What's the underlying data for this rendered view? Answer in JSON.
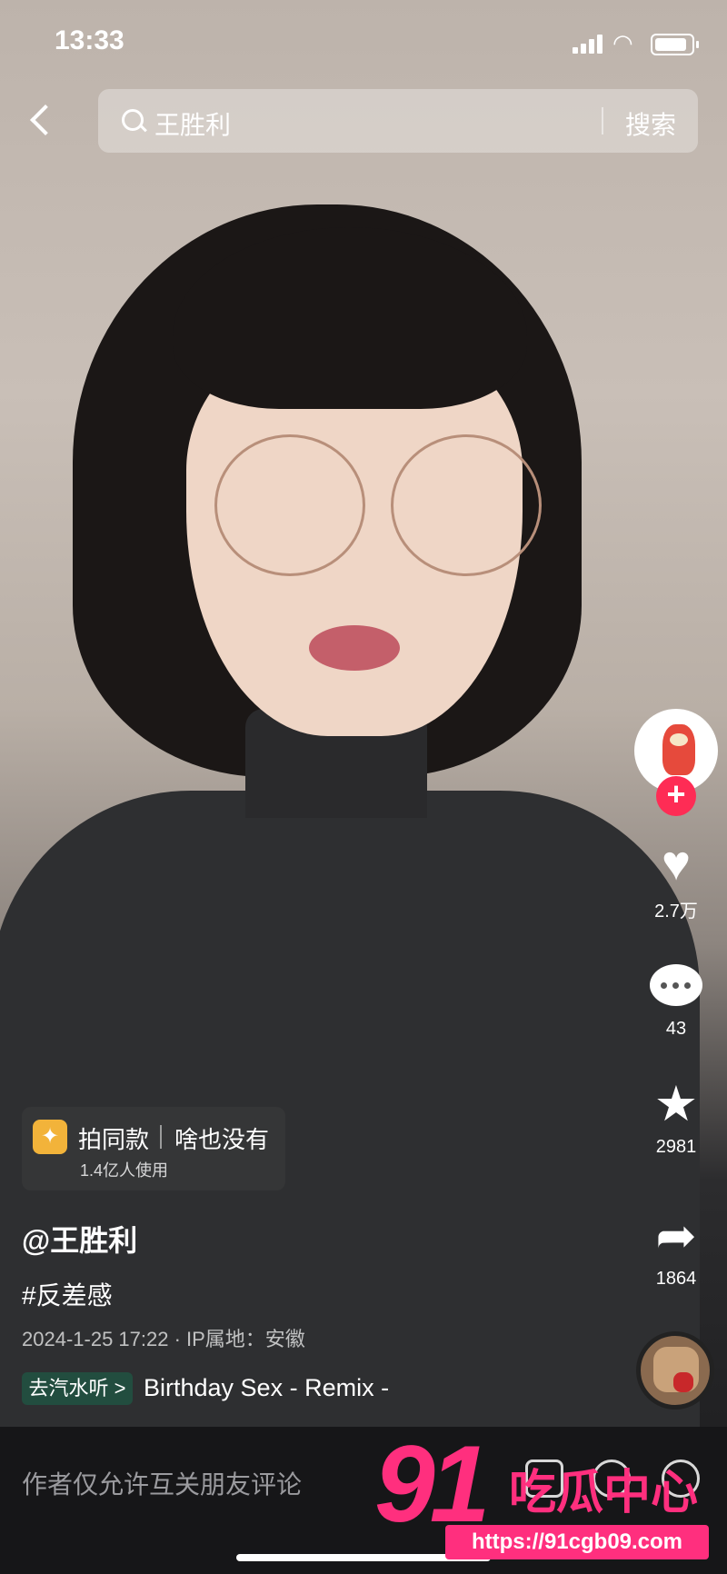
{
  "status_bar": {
    "time": "13:33"
  },
  "search": {
    "query": "王胜利",
    "button_label": "搜索"
  },
  "actions": {
    "likes": "2.7万",
    "comments": "43",
    "favorites": "2981",
    "shares": "1864"
  },
  "template": {
    "label": "拍同款",
    "title": "啥也没有",
    "usage": "1.4亿人使用"
  },
  "caption": {
    "author": "@王胜利",
    "hashtag": "#反差感",
    "meta": "2024-1-25 17:22 · IP属地：安徽"
  },
  "music": {
    "tag": "去汽水听 >",
    "title": "Birthday Sex - Remix -"
  },
  "bottom_bar": {
    "comment_hint": "作者仅允许互关朋友评论"
  },
  "watermark": {
    "number": "91",
    "name": "吃瓜中心",
    "url": "https://91cgb09.com"
  },
  "colors": {
    "accent": "#fe2c55",
    "watermark": "#ff2f7e"
  }
}
